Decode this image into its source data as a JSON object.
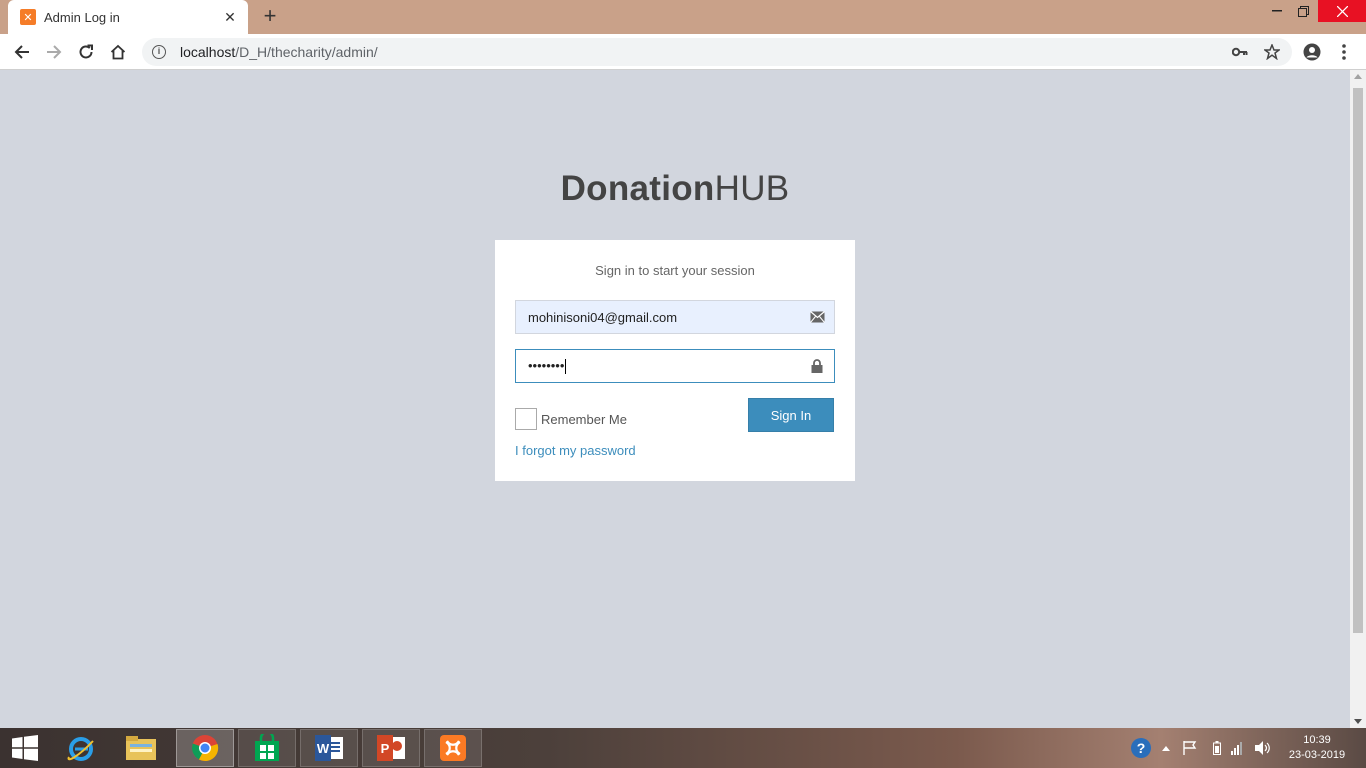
{
  "browser": {
    "tab_title": "Admin Log in",
    "url_host": "localhost",
    "url_path": "/D_H/thecharity/admin/"
  },
  "page": {
    "brand_bold": "Donation",
    "brand_light": "HUB",
    "login_message": "Sign in to start your session",
    "email_value": "mohinisoni04@gmail.com",
    "password_value": "••••••••",
    "remember_label": "Remember Me",
    "signin_label": "Sign In",
    "forgot_label": "I forgot my password"
  },
  "taskbar": {
    "time": "10:39",
    "date": "23-03-2019"
  },
  "colors": {
    "accent": "#3c8dbc",
    "page_bg": "#d2d6de",
    "titlebar": "#c9a189"
  }
}
